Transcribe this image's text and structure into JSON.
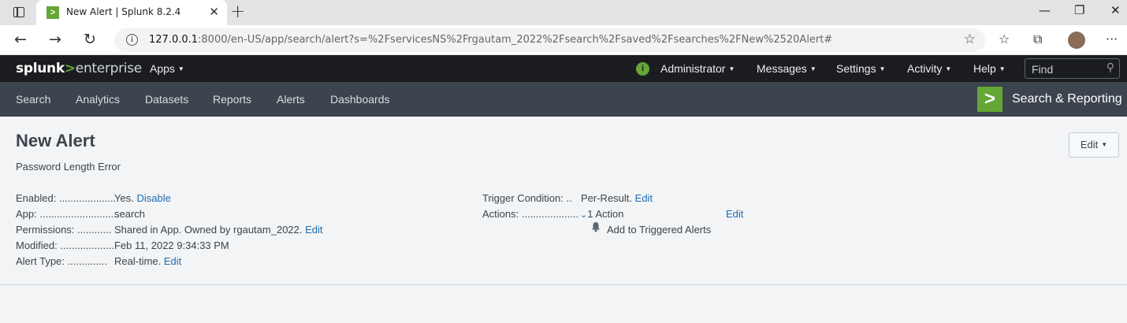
{
  "browser": {
    "tab_title": "New Alert | Splunk 8.2.4",
    "tab_close": "✕",
    "new_tab": "+",
    "url_host": "127.0.0.1",
    "url_rest": ":8000/en-US/app/search/alert?s=%2FservicesNS%2Frgautam_2022%2Fsearch%2Fsaved%2Fsearches%2FNew%2520Alert#",
    "window_minimize": "—",
    "window_restore": "❐",
    "window_close": "✕"
  },
  "splunk": {
    "logo": {
      "splunk": "splunk",
      "gt": ">",
      "enterprise": "enterprise"
    },
    "apps_menu": "Apps",
    "top_menu": [
      "Administrator",
      "Messages",
      "Settings",
      "Activity",
      "Help"
    ],
    "find_placeholder": "Find"
  },
  "appbar": {
    "nav": [
      "Search",
      "Analytics",
      "Datasets",
      "Reports",
      "Alerts",
      "Dashboards"
    ],
    "app_name": "Search & Reporting",
    "app_logo": ">"
  },
  "alert": {
    "title": "New Alert",
    "description": "Password Length Error",
    "edit_button": "Edit",
    "left_fields": [
      {
        "label": "Enabled: ....................",
        "value": "Yes.",
        "link": "Disable"
      },
      {
        "label": "App: ............................",
        "value": "search",
        "link": ""
      },
      {
        "label": "Permissions: ............",
        "value": "Shared in App. Owned by rgautam_2022.",
        "link": "Edit"
      },
      {
        "label": "Modified: ...................",
        "value": "Feb 11, 2022 9:34:33 PM",
        "link": ""
      },
      {
        "label": "Alert Type: ..............",
        "value": "Real-time.",
        "link": "Edit"
      }
    ],
    "trigger_condition": {
      "label": "Trigger Condition: ..",
      "value": "Per-Result.",
      "link": "Edit"
    },
    "actions": {
      "label": "Actions: ....................",
      "count": "1 Action",
      "link": "Edit",
      "items": [
        "Add to Triggered Alerts"
      ]
    }
  }
}
